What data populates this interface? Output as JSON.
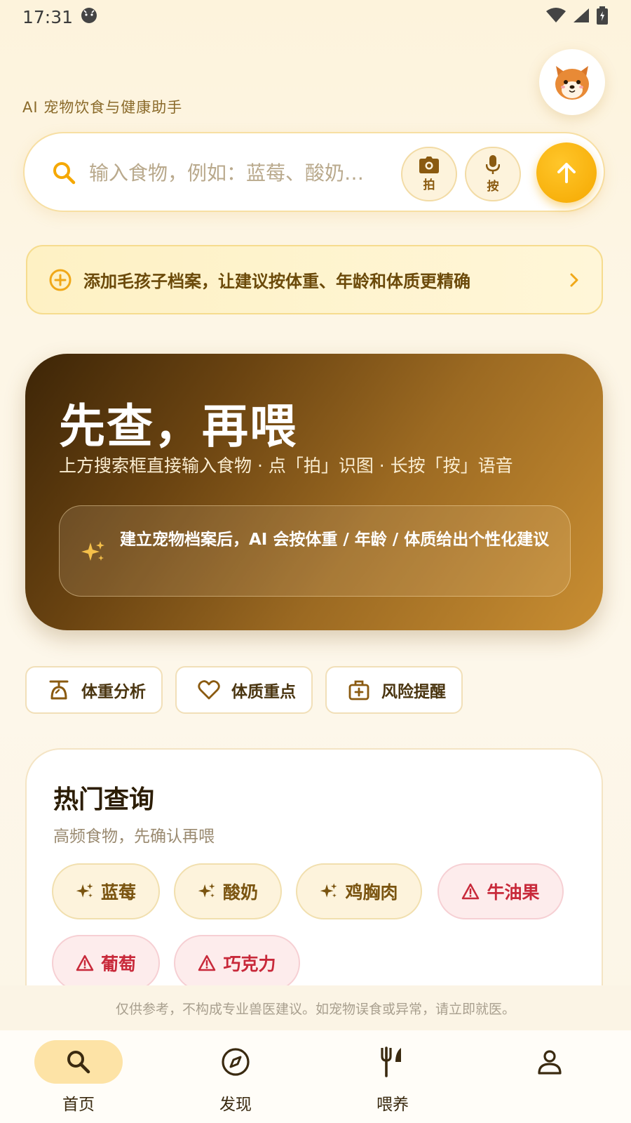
{
  "status_bar": {
    "time": "17:31"
  },
  "header": {
    "subtitle": "AI 宠物饮食与健康助手"
  },
  "search": {
    "placeholder": "输入食物，例如：蓝莓、酸奶…",
    "photo_label": "拍",
    "voice_label": "按"
  },
  "profile_banner": {
    "label": "添加毛孩子档案，让建议按体重、年龄和体质更精确"
  },
  "hero": {
    "title": "先查，再喂",
    "subtitle": "上方搜索框直接输入食物 · 点「拍」识图 · 长按「按」语音",
    "tip": "建立宠物档案后，AI 会按体重 / 年龄 / 体质给出个性化建议"
  },
  "quick_actions": [
    {
      "label": "体重分析",
      "icon": "scale-icon"
    },
    {
      "label": "体质重点",
      "icon": "heart-icon"
    },
    {
      "label": "风险提醒",
      "icon": "medkit-icon"
    }
  ],
  "hot": {
    "title": "热门查询",
    "subtitle": "高频食物，先确认再喂",
    "tags": [
      {
        "label": "蓝莓",
        "type": "safe"
      },
      {
        "label": "酸奶",
        "type": "safe"
      },
      {
        "label": "鸡胸肉",
        "type": "safe"
      },
      {
        "label": "牛油果",
        "type": "warn"
      },
      {
        "label": "葡萄",
        "type": "warn"
      },
      {
        "label": "巧克力",
        "type": "warn"
      }
    ]
  },
  "disclaimer": "仅供参考，不构成专业兽医建议。如宠物误食或异常，请立即就医。",
  "nav": [
    {
      "label": "首页",
      "icon": "search-icon",
      "active": true
    },
    {
      "label": "发现",
      "icon": "compass-icon",
      "active": false
    },
    {
      "label": "喂养",
      "icon": "fork-knife-icon",
      "active": false
    },
    {
      "label": "",
      "icon": "person-icon",
      "active": false
    }
  ],
  "colors": {
    "accent": "#f5a800",
    "warn": "#c8293a",
    "brand_brown": "#6b4a0a"
  }
}
